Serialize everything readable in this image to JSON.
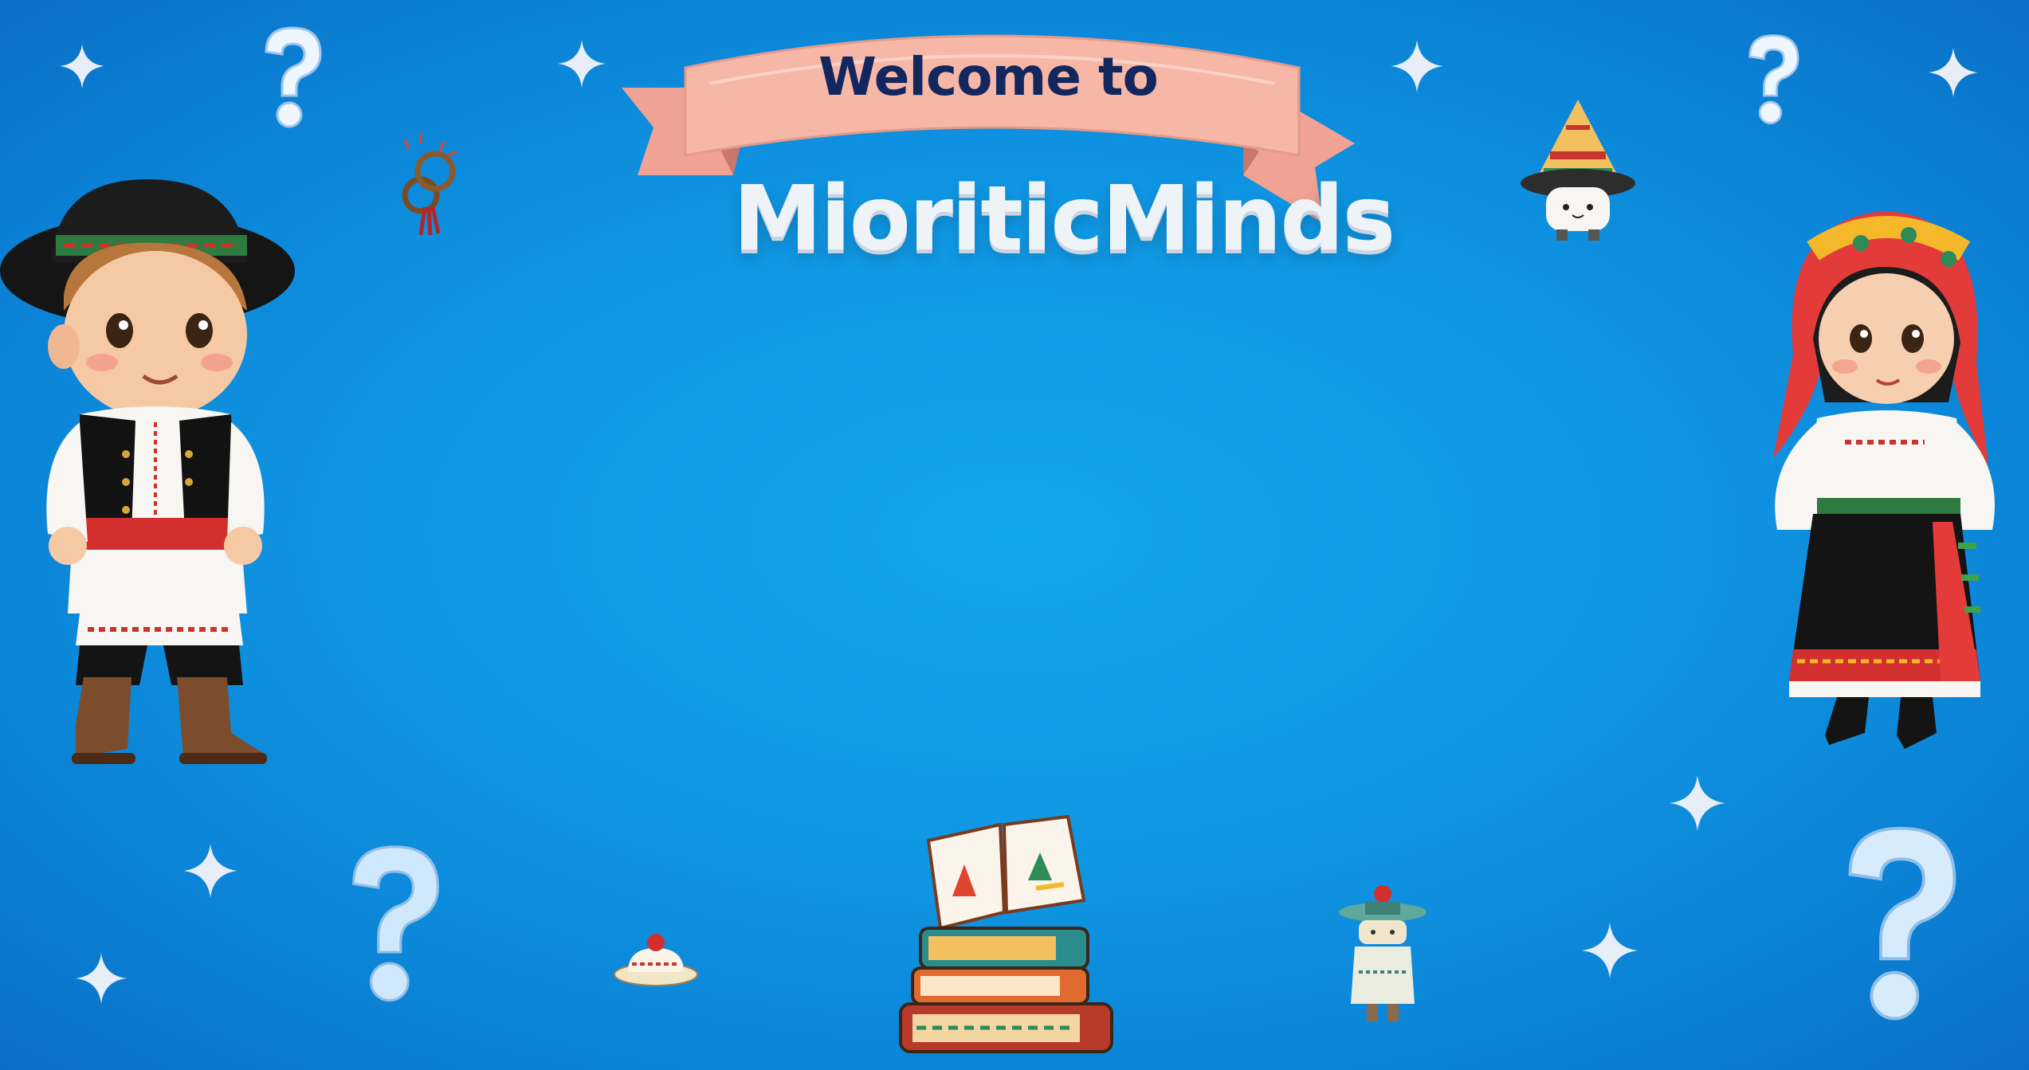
{
  "banner": {
    "welcome": "Welcome to"
  },
  "title": {
    "text": "MioriticMinds"
  },
  "icons": {
    "question": "question-mark-icon",
    "sparkle": "sparkle-icon"
  },
  "colors": {
    "background": "#0f96e3",
    "banner": "#f6b6a6",
    "title": "#eef3f8",
    "welcome": "#13275f"
  }
}
